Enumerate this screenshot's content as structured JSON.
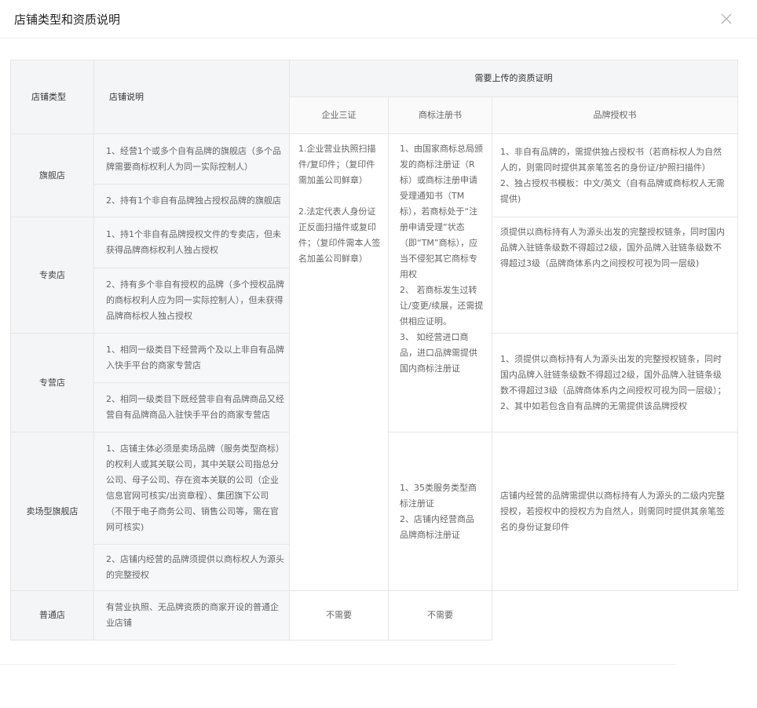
{
  "dialog": {
    "title": "店铺类型和资质说明",
    "close_icon": "close-icon"
  },
  "table": {
    "headers": {
      "type": "店铺类型",
      "desc": "店铺说明",
      "qual": "需要上传的资质证明",
      "col_license": "企业三证",
      "col_trademark": "商标注册书",
      "col_auth": "品牌授权书"
    },
    "rows": {
      "flagship": {
        "type": "旗舰店",
        "desc1": "1、经营1个或多个自有品牌的旗舰店（多个品牌需要商标权利人为同一实际控制人）",
        "desc2": "2、持有1个非自有品牌独占授权品牌的旗舰店",
        "auth": [
          "1、非自有品牌的，需提供独占授权书（若商标权人为自然人的，则需同时提供其亲笔签名的身份证/护照扫描件）",
          "2、独占授权书模板：中文/英文（自有品牌或商标权人无需提供)"
        ]
      },
      "exclusive": {
        "type": "专卖店",
        "desc1": "1、持1个非自有品牌授权文件的专卖店，但未获得品牌商标权利人独占授权",
        "desc2": "2、持有多个非自有授权的品牌（多个授权品牌的商标权利人应为同一实际控制人），但未获得品牌商标权人独占授权",
        "auth": "须提供以商标持有人为源头出发的完整授权链条，同时国内品牌入驻链条级数不得超过2级，国外品牌入驻链条级数不得超过3级（品牌商体系内之间授权可视为同一层级)"
      },
      "specialty": {
        "type": "专营店",
        "desc1": "1、相同一级类目下经营两个及以上非自有品牌入快手平台的商家专营店",
        "desc2": "2、相同一级类目下既经营非自有品牌商品又经营自有品牌商品入驻快手平台的商家专营店",
        "auth": [
          "1、须提供以商标持有人为源头出发的完整授权链条，同时国内品牌入驻链条级数不得超过2级，国外品牌入驻链条级数不得超过3级（品牌商体系内之间授权可视为同一层级）；",
          "2、其中如若包含自有品牌的无需提供该品牌授权"
        ]
      },
      "mall": {
        "type": "卖场型旗舰店",
        "desc1": "1、店铺主体必须是卖场品牌（服务类型商标）的权利人或其关联公司，其中关联公司指总分公司、母子公司、存在资本关联的公司（企业信息官网可核实/出资章程）、集团旗下公司（不限于电子商务公司、销售公司等，需在官网可核实)",
        "desc2": "2、店铺内经营的品牌须提供以商标权人为源头的完整授权",
        "trademark": [
          "1、35类服务类型商标注册证",
          "2、店铺内经营商品品牌商标注册证"
        ],
        "auth": "店铺内经营的品牌需提供以商标持有人为源头的二级内完整授权，若授权中的授权方为自然人，则需同时提供其亲笔签名的身份证复印件"
      },
      "normal": {
        "type": "普通店",
        "desc": "有营业执照、无品牌资质的商家开设的普通企业店铺",
        "trademark": "不需要",
        "auth": "不需要"
      }
    },
    "license_text": [
      "1.企业营业执照扫描件/复印件；（复印件需加盖公司鲜章）",
      "2.法定代表人身份证正反面扫描件或复印件；（复印件需本人签名加盖公司鲜章）"
    ],
    "trademark_text": [
      "1、由国家商标总局颁发的商标注册证（R标）或商标注册申请受理通知书（TM标），若商标处于“注册申请受理”状态（即“TM”商标），应当不侵犯其它商标专用权",
      "2、 若商标发生过转让/变更/续展，还需提供相应证明。",
      "3、 如经营进口商品，进口品牌需提供国内商标注册证"
    ]
  }
}
